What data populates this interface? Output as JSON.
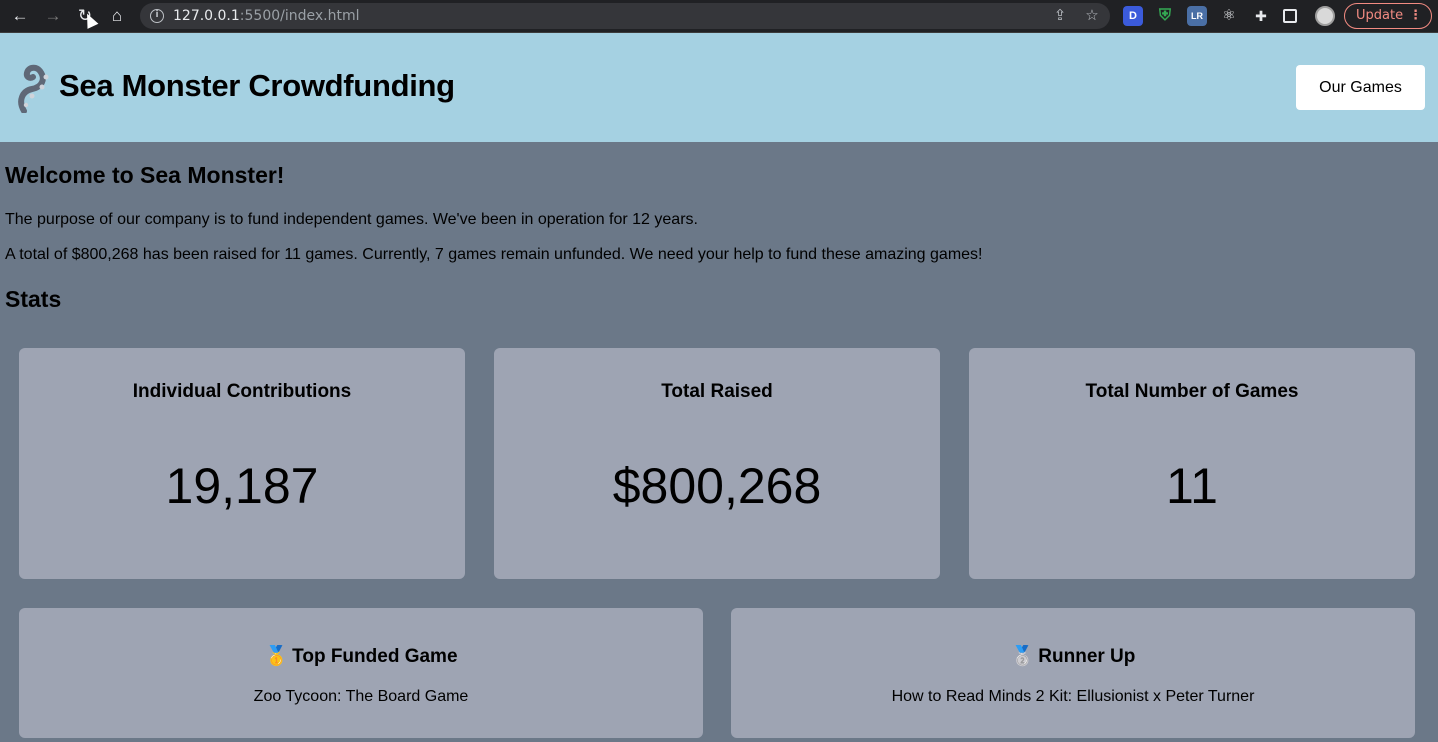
{
  "browser": {
    "url_host": "127.0.0.1",
    "url_rest": ":5500/index.html",
    "update_label": "Update",
    "extensions": [
      "D",
      "shield",
      "LR",
      "react",
      "puzzle"
    ]
  },
  "header": {
    "title": "Sea Monster Crowdfunding",
    "nav_button": "Our Games"
  },
  "welcome": {
    "heading": "Welcome to Sea Monster!",
    "line1": "The purpose of our company is to fund independent games. We've been in operation for 12 years.",
    "line2": "A total of $800,268 has been raised for 11 games. Currently, 7 games remain unfunded. We need your help to fund these amazing games!"
  },
  "stats": {
    "heading": "Stats",
    "cards": [
      {
        "label": "Individual Contributions",
        "value": "19,187"
      },
      {
        "label": "Total Raised",
        "value": "$800,268"
      },
      {
        "label": "Total Number of Games",
        "value": "11"
      }
    ]
  },
  "games": {
    "top": {
      "medal": "🥇",
      "label": "Top Funded Game",
      "name": "Zoo Tycoon: The Board Game"
    },
    "runner": {
      "medal": "🥈",
      "label": "Runner Up",
      "name": "How to Read Minds 2 Kit: Ellusionist x Peter Turner"
    }
  }
}
